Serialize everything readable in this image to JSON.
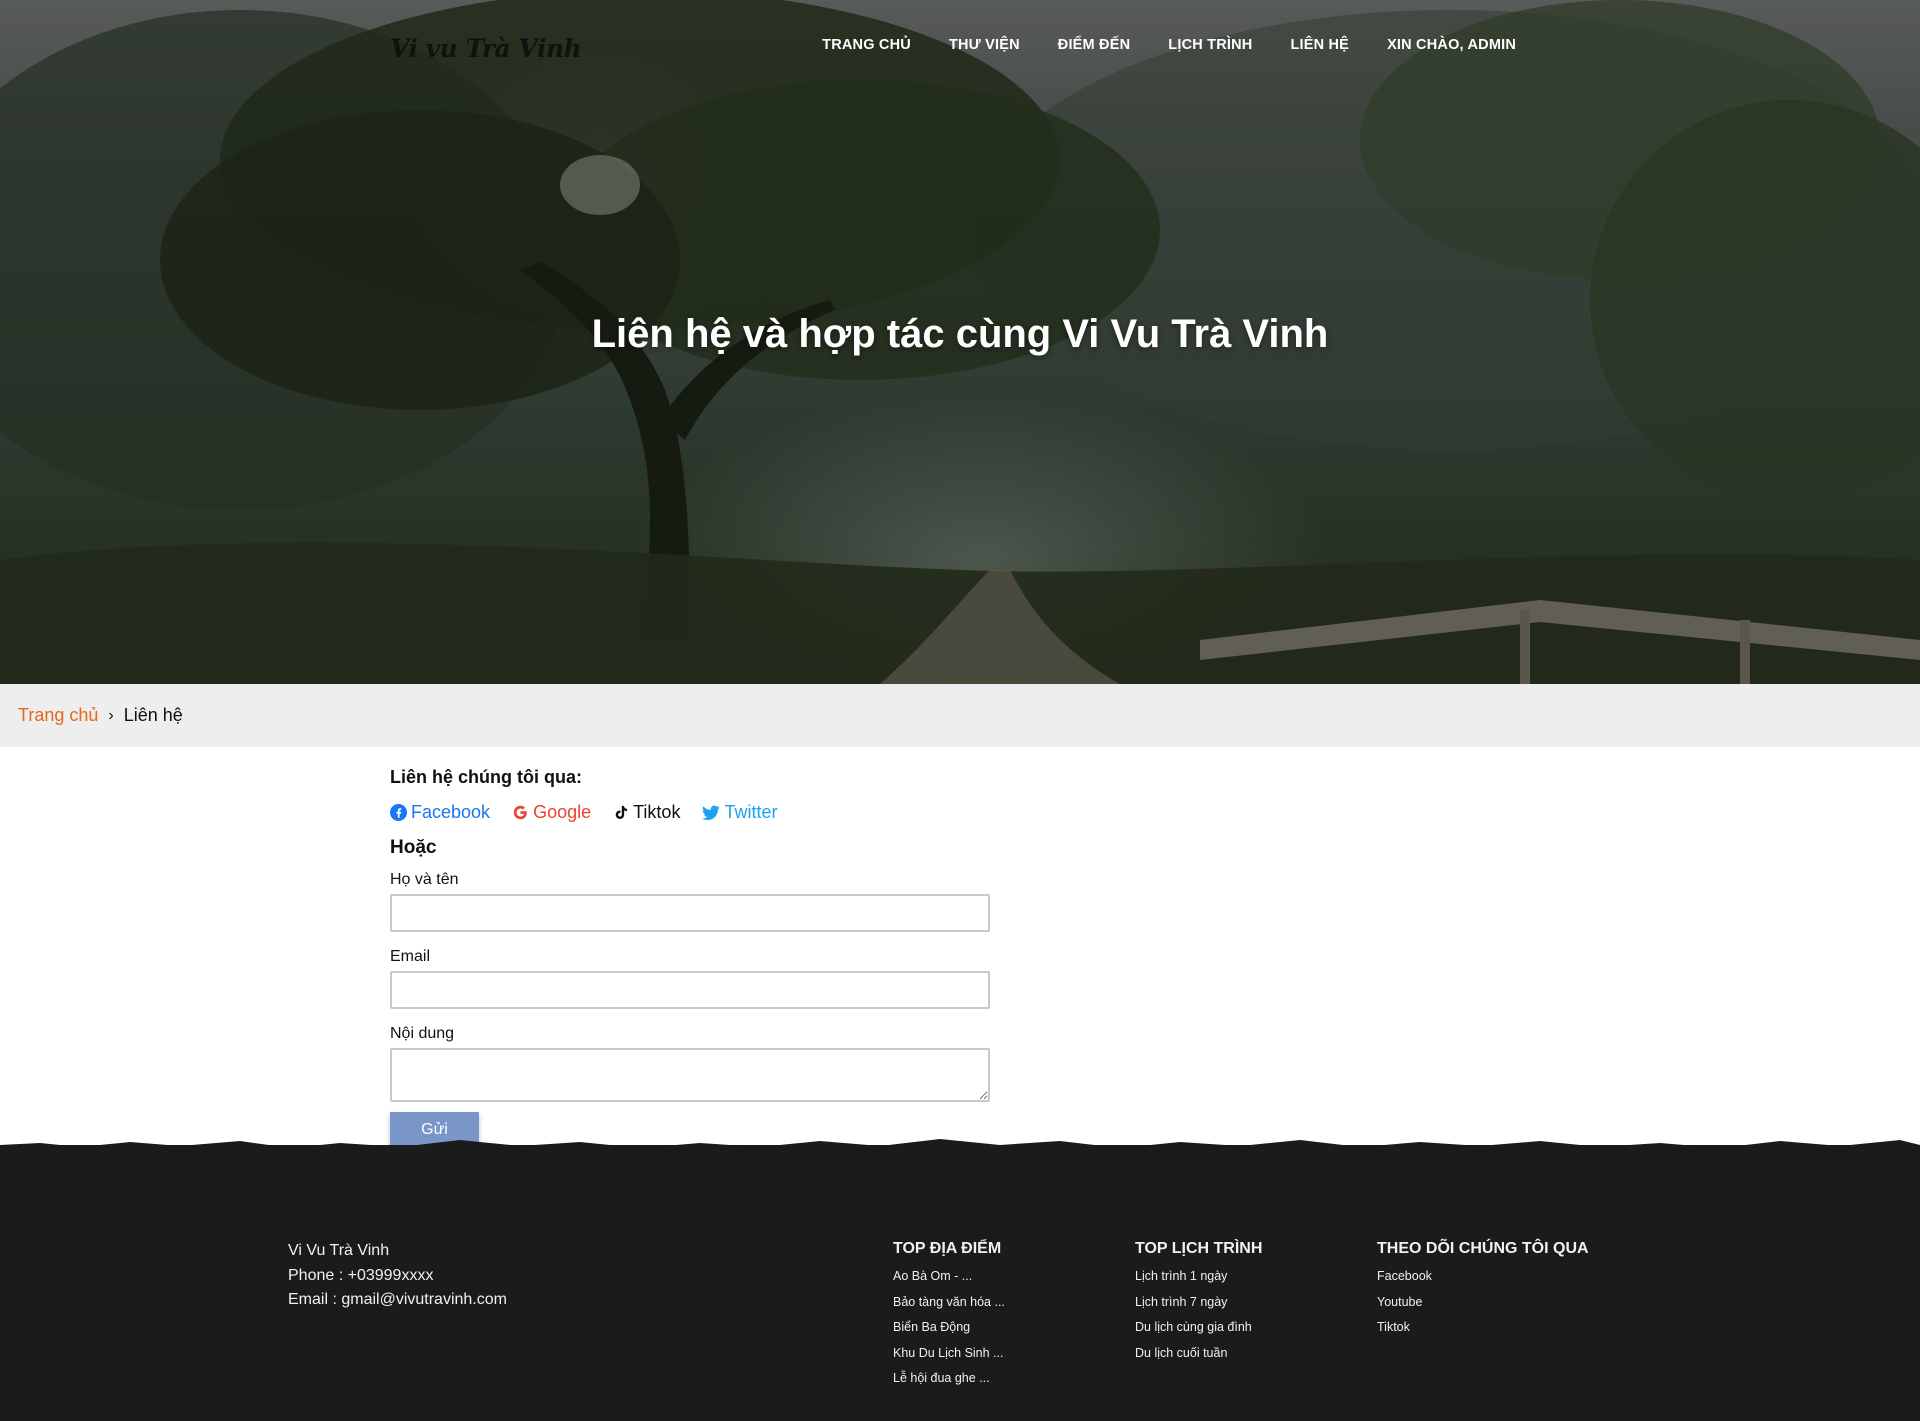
{
  "header": {
    "logo": "Vi vu Trà Vinh",
    "nav": [
      {
        "label": "TRANG CHỦ"
      },
      {
        "label": "THƯ VIỆN"
      },
      {
        "label": "ĐIỂM ĐẾN"
      },
      {
        "label": "LỊCH TRÌNH"
      },
      {
        "label": "LIÊN HỆ"
      },
      {
        "label": "XIN CHÀO, ADMIN"
      }
    ]
  },
  "hero": {
    "title": "Liên hệ và hợp tác cùng Vi Vu Trà Vinh"
  },
  "breadcrumb": {
    "home": "Trang chủ",
    "separator": "›",
    "current": "Liên hệ"
  },
  "contact": {
    "heading": "Liên hệ chúng tôi qua:",
    "socials": [
      {
        "label": "Facebook",
        "icon": "facebook-icon",
        "color": "#1877f2"
      },
      {
        "label": "Google",
        "icon": "google-icon",
        "color": "#ea4335"
      },
      {
        "label": "Tiktok",
        "icon": "tiktok-icon",
        "color": "#111111"
      },
      {
        "label": "Twitter",
        "icon": "twitter-icon",
        "color": "#1da1f2"
      }
    ],
    "or_label": "Hoặc",
    "form": {
      "name_label": "Họ và tên",
      "name_value": "",
      "email_label": "Email",
      "email_value": "",
      "content_label": "Nội dung",
      "content_value": "",
      "submit_label": "Gửi"
    }
  },
  "footer": {
    "site_name": "Vi Vu Trà Vinh",
    "phone": "Phone : +03999xxxx",
    "email": "Email : gmail@vivutravinh.com",
    "columns": [
      {
        "title": "TOP ĐỊA ĐIỂM",
        "items": [
          "Ao Bà Om - ...",
          "Bảo tàng văn hóa ...",
          "Biển Ba Động",
          "Khu Du Lịch Sinh ...",
          "Lễ hội đua ghe ..."
        ]
      },
      {
        "title": "TOP LỊCH TRÌNH",
        "items": [
          "Lịch trình 1 ngày",
          "Lịch trình 7 ngày",
          "Du lịch cùng gia đình",
          "Du lịch cuối tuần"
        ]
      },
      {
        "title": "THEO DÕI CHÚNG TÔI QUA",
        "items": [
          "Facebook",
          "Youtube",
          "Tiktok"
        ]
      }
    ]
  },
  "colors": {
    "accent": "#e8651b",
    "submit": "#7a96c8",
    "footer_bg": "#1b1b1b",
    "breadcrumb_bg": "#eeeeee"
  }
}
